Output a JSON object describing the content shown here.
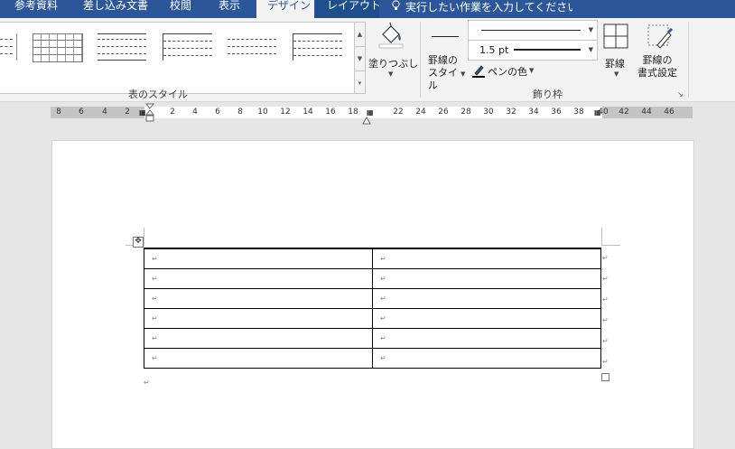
{
  "tabs": [
    {
      "label": "参考資料",
      "state": "normal"
    },
    {
      "label": "差し込み文書",
      "state": "normal"
    },
    {
      "label": "校閲",
      "state": "normal"
    },
    {
      "label": "表示",
      "state": "normal"
    },
    {
      "label": "デザイン",
      "state": "active"
    },
    {
      "label": "レイアウト",
      "state": "highlight"
    }
  ],
  "tell_me": {
    "icon": "lightbulb-icon",
    "placeholder": "実行したい作業を入力してください"
  },
  "ribbon": {
    "table_styles": {
      "group_label": "表のスタイル"
    },
    "shading": {
      "label": "塗りつぶし",
      "icon": "paint-bucket-icon"
    },
    "borders_group": {
      "group_label": "飾り枠",
      "border_styles_label": "罫線の\nスタイル",
      "line_weight": "1.5 pt",
      "pen_color_label": "ペンの色",
      "borders_label": "罫線",
      "border_painter_label": "罫線の\n書式設定"
    }
  },
  "ruler": {
    "left_numbers": [
      "8",
      "6",
      "4",
      "2"
    ],
    "right_numbers": [
      "2",
      "4",
      "6",
      "8",
      "10",
      "12",
      "14",
      "16",
      "18"
    ],
    "right2_numbers": [
      "22",
      "24",
      "26",
      "28",
      "30",
      "32",
      "34",
      "36",
      "38"
    ],
    "far_numbers": [
      "40",
      "42",
      "44",
      "46"
    ]
  },
  "table": {
    "rows": 6,
    "columns": 2,
    "cell_mark": "↵"
  },
  "colors": {
    "tabbar": "#2b579a",
    "ribbon_bg": "#f3f3f3",
    "workspace_bg": "#e6e6e6"
  }
}
